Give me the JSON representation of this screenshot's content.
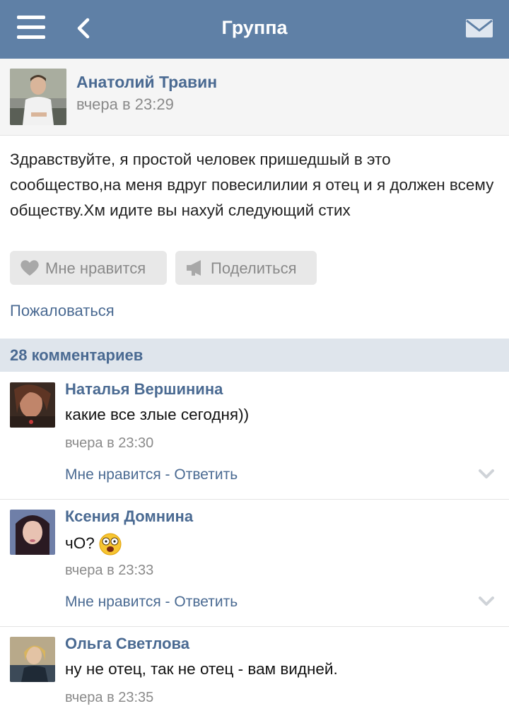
{
  "header": {
    "title": "Группа",
    "menu_icon": "hamburger-icon",
    "back_icon": "chevron-left-icon",
    "mail_icon": "envelope-icon",
    "bg_color": "#5f80a6"
  },
  "post": {
    "author": "Анатолий Травин",
    "time": "вчера в 23:29",
    "text": "Здравствуйте, я простой человек пришедшый в это сообщество,на меня вдруг повесилилии я отец и я должен всему обществу.Хм идите вы нахуй следующий стих",
    "like_label": "Мне нравится",
    "share_label": "Поделиться",
    "report_label": "Пожаловаться"
  },
  "comments_header": "28 комментариев",
  "comments": [
    {
      "author": "Наталья Вершинина",
      "text": "какие все злые сегодня))",
      "time": "вчера в 23:30",
      "like": "Мне нравится",
      "sep": " - ",
      "reply": "Ответить"
    },
    {
      "author": "Ксения Домнина",
      "text": "чО?",
      "emoji": "shocked-face-emoji",
      "time": "вчера в 23:33",
      "like": "Мне нравится",
      "sep": " - ",
      "reply": "Ответить"
    },
    {
      "author": "Ольга Светлова",
      "text": "ну не отец, так не отец - вам видней.",
      "time": "вчера в 23:35"
    }
  ]
}
